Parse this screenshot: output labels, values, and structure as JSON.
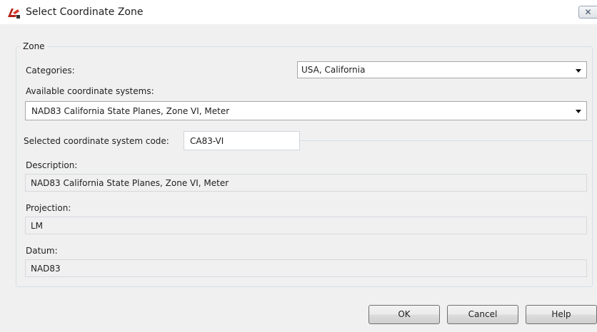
{
  "window": {
    "title": "Select Coordinate Zone",
    "close_glyph": "✕"
  },
  "zone": {
    "legend": "Zone",
    "categories_label": "Categories:",
    "categories_value": "USA, California",
    "available_label": "Available coordinate systems:",
    "available_value": "NAD83 California State Planes, Zone VI, Meter",
    "code_label": "Selected coordinate system code:",
    "code_value": "CA83-VI",
    "description_label": "Description:",
    "description_value": "NAD83 California State Planes, Zone VI, Meter",
    "projection_label": "Projection:",
    "projection_value": "LM",
    "datum_label": "Datum:",
    "datum_value": "NAD83"
  },
  "buttons": {
    "ok": "OK",
    "cancel": "Cancel",
    "help": "Help"
  },
  "icons": {
    "app": "autocad-map-icon",
    "close": "close-icon",
    "dropdown": "chevron-down-icon"
  }
}
